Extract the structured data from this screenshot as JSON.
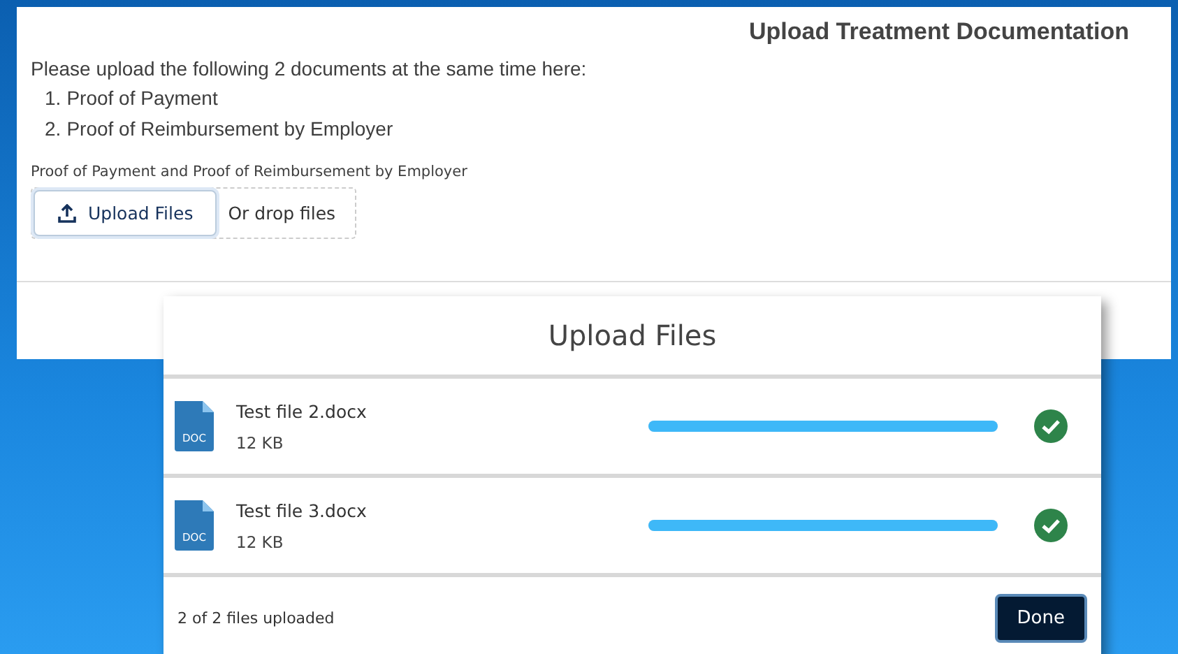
{
  "panel": {
    "title": "Upload Treatment Documentation",
    "intro": "Please upload the following 2 documents at the same time here:",
    "documents": [
      {
        "number": "1.",
        "label": "Proof of Payment"
      },
      {
        "number": "2.",
        "label": "Proof of Reimbursement by Employer"
      }
    ],
    "field_label": "Proof of Payment and Proof of Reimbursement by Employer",
    "upload_button": "Upload Files",
    "drop_hint": "Or drop files"
  },
  "modal": {
    "title": "Upload Files",
    "files": [
      {
        "name": "Test file 2.docx",
        "size": "12 KB",
        "icon_label": "DOC",
        "level": 1,
        "complete": true
      },
      {
        "name": "Test file 3.docx",
        "size": "12 KB",
        "icon_label": "DOC",
        "level": 1,
        "complete": true
      }
    ],
    "status": "2 of 2 files uploaded",
    "done_button": "Done"
  }
}
